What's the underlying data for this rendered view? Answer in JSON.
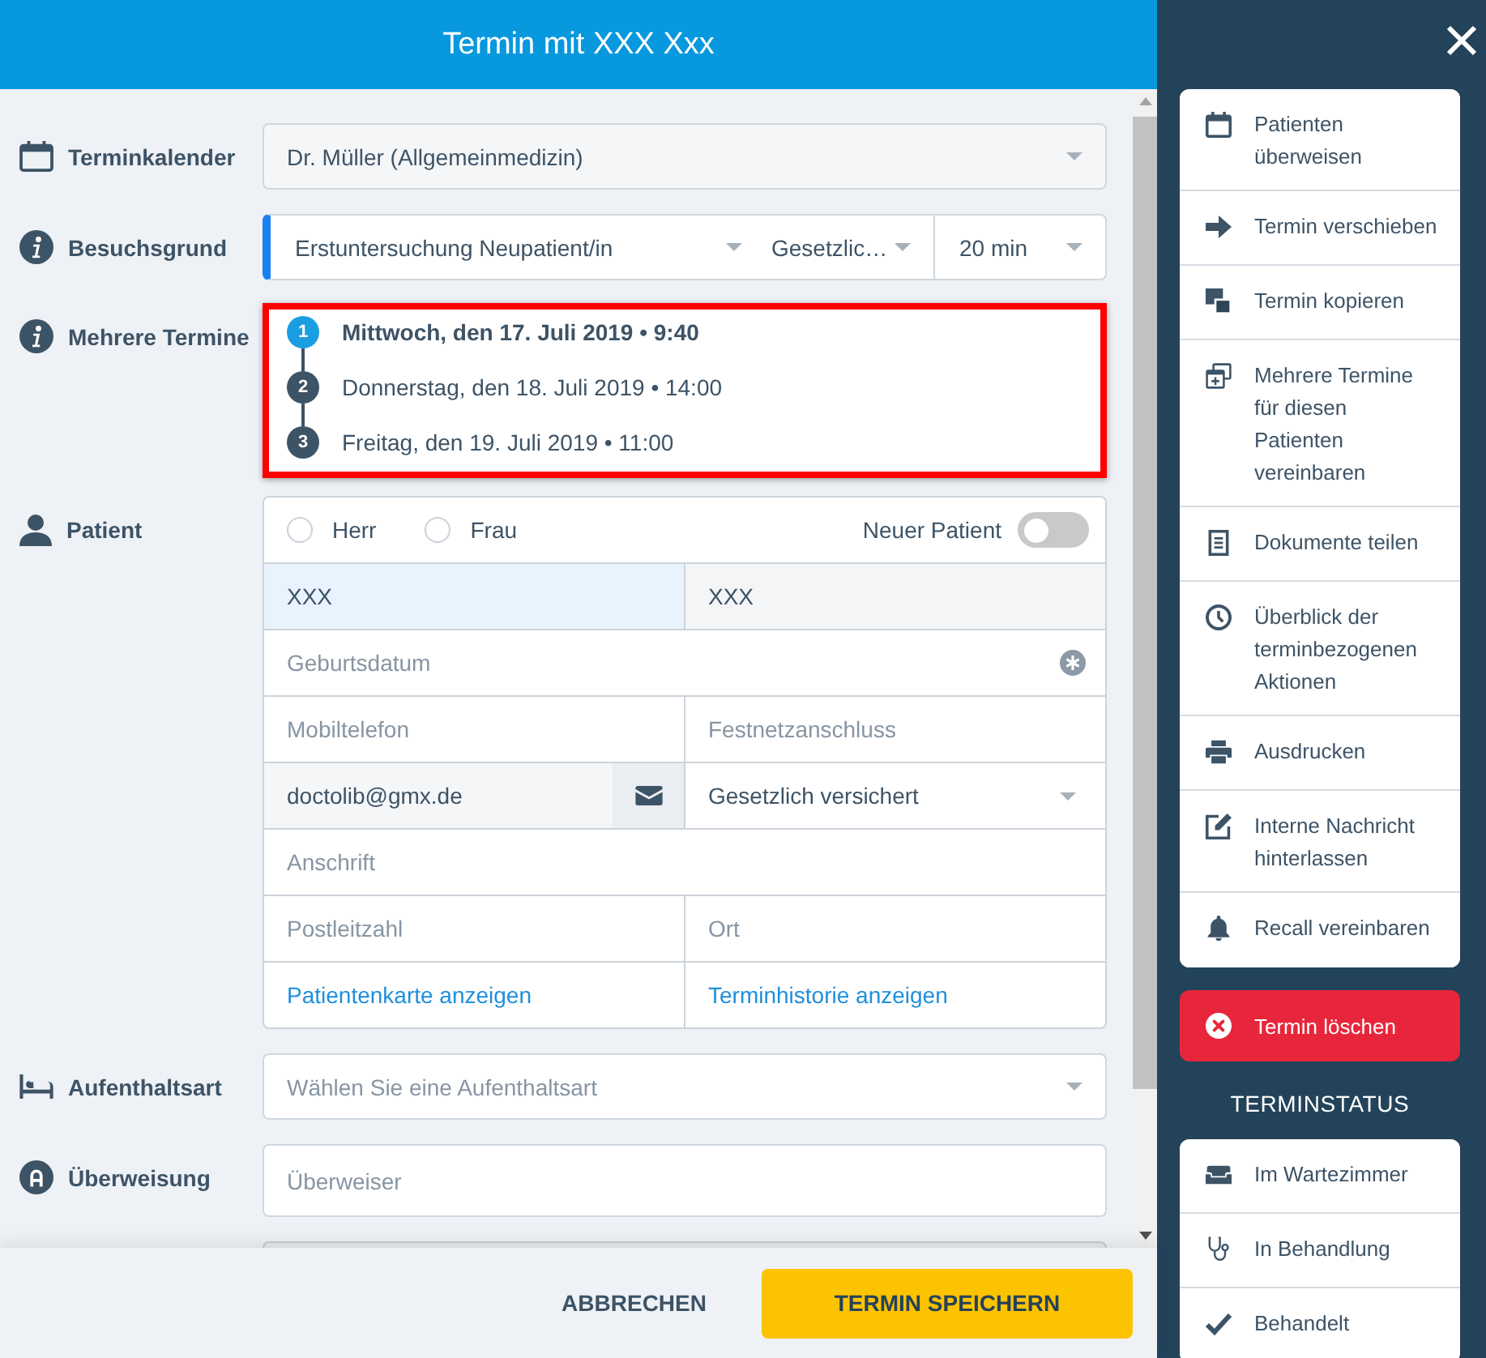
{
  "header": {
    "title": "Termin mit XXX Xxx"
  },
  "form": {
    "calendar": {
      "label": "Terminkalender",
      "value": "Dr. Müller (Allgemeinmedizin)"
    },
    "visit_reason": {
      "label": "Besuchsgrund",
      "reason": "Erstuntersuchung Neupatient/in",
      "insurance": "Gesetzlic…",
      "duration": "20 min"
    },
    "multiple_appointments": {
      "label": "Mehrere Termine",
      "highlighted": true,
      "appointments": [
        {
          "number": "1",
          "text": "Mittwoch, den 17. Juli 2019 • 9:40",
          "selected": true
        },
        {
          "number": "2",
          "text": "Donnerstag, den 18. Juli 2019 • 14:00",
          "selected": false
        },
        {
          "number": "3",
          "text": "Freitag, den 19. Juli 2019 • 11:00",
          "selected": false
        }
      ]
    },
    "patient": {
      "label": "Patient",
      "salutations": [
        {
          "label": "Herr",
          "selected": false
        },
        {
          "label": "Frau",
          "selected": false
        }
      ],
      "new_patient": {
        "label": "Neuer Patient",
        "on": false
      },
      "rows": [
        [
          {
            "kind": "text",
            "value": "XXX",
            "focused": true
          },
          {
            "kind": "text",
            "value": "XXX",
            "focused": false
          }
        ],
        [
          {
            "kind": "date",
            "placeholder": "Geburtsdatum",
            "required": true
          }
        ],
        [
          {
            "kind": "text",
            "placeholder": "Mobiltelefon",
            "focused": false
          },
          {
            "kind": "text",
            "placeholder": "Festnetzanschluss",
            "focused": false
          }
        ],
        [
          {
            "kind": "email",
            "value": "doctolib@gmx.de"
          },
          {
            "kind": "select",
            "value": "Gesetzlich versichert"
          }
        ],
        [
          {
            "kind": "text",
            "placeholder": "Anschrift",
            "focused": false
          }
        ],
        [
          {
            "kind": "text",
            "placeholder": "Postleitzahl",
            "focused": false
          },
          {
            "kind": "text",
            "placeholder": "Ort",
            "focused": false
          }
        ],
        [
          {
            "kind": "link",
            "label": "Patientenkarte anzeigen"
          },
          {
            "kind": "link",
            "label": "Terminhistorie anzeigen"
          }
        ]
      ]
    },
    "stay_type": {
      "label": "Aufenthaltsart",
      "placeholder": "Wählen Sie eine Aufenthaltsart"
    },
    "referral": {
      "label": "Überweisung",
      "placeholder": "Überweiser"
    }
  },
  "footer": {
    "cancel": "ABBRECHEN",
    "save": "TERMIN SPEICHERN"
  },
  "sidebar": {
    "actions": [
      "Patienten überweisen",
      "Termin verschieben",
      "Termin kopieren",
      "Mehrere Termine für diesen Patienten vereinbaren",
      "Dokumente teilen",
      "Überblick der terminbezogenen Aktionen",
      "Ausdrucken",
      "Interne Nachricht hinterlassen",
      "Recall vereinbaren"
    ],
    "delete": "Termin löschen",
    "status_title": "TERMINSTATUS",
    "statuses": [
      "Im Wartezimmer",
      "In Behandlung",
      "Behandelt"
    ]
  }
}
